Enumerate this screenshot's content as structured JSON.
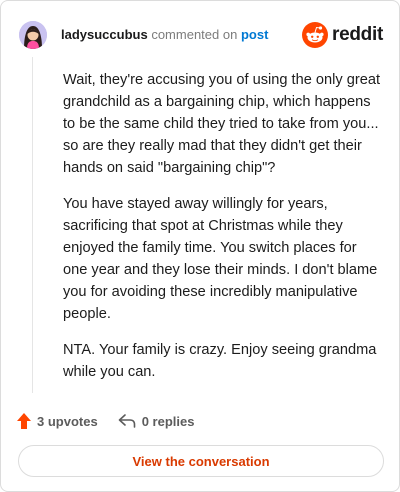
{
  "comment": {
    "author": "ladysuccubus",
    "action_text": "commented on",
    "post_link": "post",
    "paragraphs": [
      "Wait, they're accusing you of using the only great grandchild as a bargaining chip, which happens to be the same child they tried to take from you... so are they really mad that they didn't get their hands on said \"bargaining chip\"?",
      "You have stayed away willingly for years, sacrificing that spot at Christmas while they enjoyed the family time. You switch places for one year and they lose their minds. I don't blame you for avoiding these incredibly manipulative people.",
      "NTA. Your family is crazy. Enjoy seeing grandma while you can."
    ]
  },
  "brand": {
    "name": "reddit",
    "icon": "reddit-snoo-icon",
    "color": "#ff4500"
  },
  "actions": {
    "upvotes": "3 upvotes",
    "replies": "0 replies"
  },
  "view_button_label": "View the conversation",
  "colors": {
    "link": "#0079d3",
    "accent": "#d93a00",
    "upvote": "#ff4500"
  }
}
